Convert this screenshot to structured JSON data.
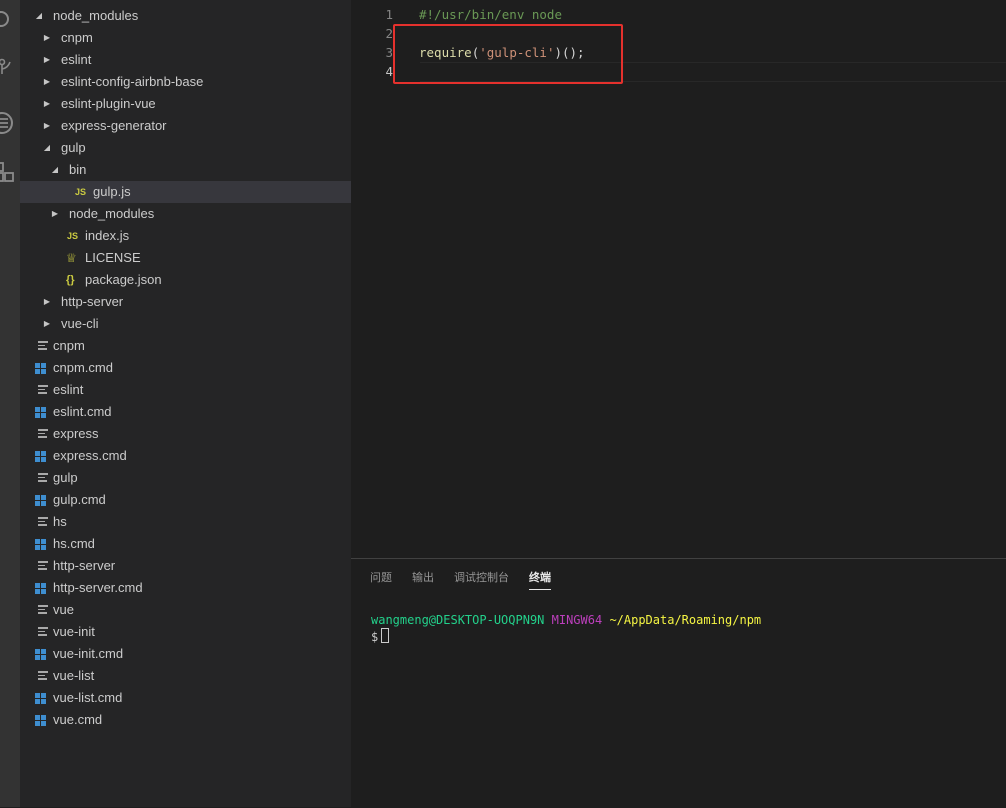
{
  "activity_bar": {
    "icons": [
      "search-icon",
      "source-control-icon",
      "debug-icon",
      "extensions-icon"
    ]
  },
  "explorer": {
    "items": [
      {
        "label": "node_modules",
        "kind": "folder-open",
        "depth": 1
      },
      {
        "label": "cnpm",
        "kind": "folder",
        "depth": 2
      },
      {
        "label": "eslint",
        "kind": "folder",
        "depth": 2
      },
      {
        "label": "eslint-config-airbnb-base",
        "kind": "folder",
        "depth": 2
      },
      {
        "label": "eslint-plugin-vue",
        "kind": "folder",
        "depth": 2
      },
      {
        "label": "express-generator",
        "kind": "folder",
        "depth": 2
      },
      {
        "label": "gulp",
        "kind": "folder-open",
        "depth": 2
      },
      {
        "label": "bin",
        "kind": "folder-open",
        "depth": 3
      },
      {
        "label": "gulp.js",
        "kind": "js",
        "depth": 4,
        "icon_text": "JS",
        "selected": true
      },
      {
        "label": "node_modules",
        "kind": "folder",
        "depth": 3
      },
      {
        "label": "index.js",
        "kind": "js",
        "depth": 3,
        "icon_text": "JS"
      },
      {
        "label": "LICENSE",
        "kind": "license",
        "depth": 3
      },
      {
        "label": "package.json",
        "kind": "json",
        "depth": 3,
        "icon_text": "{}"
      },
      {
        "label": "http-server",
        "kind": "folder",
        "depth": 2
      },
      {
        "label": "vue-cli",
        "kind": "folder",
        "depth": 2
      },
      {
        "label": "cnpm",
        "kind": "text",
        "depth": 1
      },
      {
        "label": "cnpm.cmd",
        "kind": "cmd",
        "depth": 1
      },
      {
        "label": "eslint",
        "kind": "text",
        "depth": 1
      },
      {
        "label": "eslint.cmd",
        "kind": "cmd",
        "depth": 1
      },
      {
        "label": "express",
        "kind": "text",
        "depth": 1
      },
      {
        "label": "express.cmd",
        "kind": "cmd",
        "depth": 1
      },
      {
        "label": "gulp",
        "kind": "text",
        "depth": 1
      },
      {
        "label": "gulp.cmd",
        "kind": "cmd",
        "depth": 1
      },
      {
        "label": "hs",
        "kind": "text",
        "depth": 1
      },
      {
        "label": "hs.cmd",
        "kind": "cmd",
        "depth": 1
      },
      {
        "label": "http-server",
        "kind": "text",
        "depth": 1
      },
      {
        "label": "http-server.cmd",
        "kind": "cmd",
        "depth": 1
      },
      {
        "label": "vue",
        "kind": "text",
        "depth": 1
      },
      {
        "label": "vue-init",
        "kind": "text",
        "depth": 1
      },
      {
        "label": "vue-init.cmd",
        "kind": "cmd",
        "depth": 1
      },
      {
        "label": "vue-list",
        "kind": "text",
        "depth": 1
      },
      {
        "label": "vue-list.cmd",
        "kind": "cmd",
        "depth": 1
      },
      {
        "label": "vue.cmd",
        "kind": "cmd",
        "depth": 1
      }
    ]
  },
  "editor": {
    "lines": [
      {
        "number": "1",
        "tokens": [
          {
            "text": "#!/usr/bin/env node",
            "class": "c-comment"
          }
        ]
      },
      {
        "number": "2",
        "tokens": []
      },
      {
        "number": "3",
        "tokens": [
          {
            "text": "require",
            "class": "c-fn"
          },
          {
            "text": "(",
            "class": "c-punc"
          },
          {
            "text": "'gulp-cli'",
            "class": "c-str"
          },
          {
            "text": ")();",
            "class": "c-punc"
          }
        ]
      },
      {
        "number": "4",
        "tokens": [],
        "active": true
      }
    ]
  },
  "panel": {
    "tabs": [
      {
        "label": "问题",
        "active": false
      },
      {
        "label": "输出",
        "active": false
      },
      {
        "label": "调试控制台",
        "active": false
      },
      {
        "label": "终端",
        "active": true
      }
    ],
    "terminal": {
      "user_host": "wangmeng@DESKTOP-UOQPN9N",
      "system": "MINGW64",
      "path": "~/AppData/Roaming/npm",
      "prompt": "$"
    }
  },
  "colors": {
    "highlight_box": "#e5312d",
    "terminal_user": "#23d18b",
    "terminal_system": "#bc3fbc",
    "terminal_path": "#f5f543"
  }
}
